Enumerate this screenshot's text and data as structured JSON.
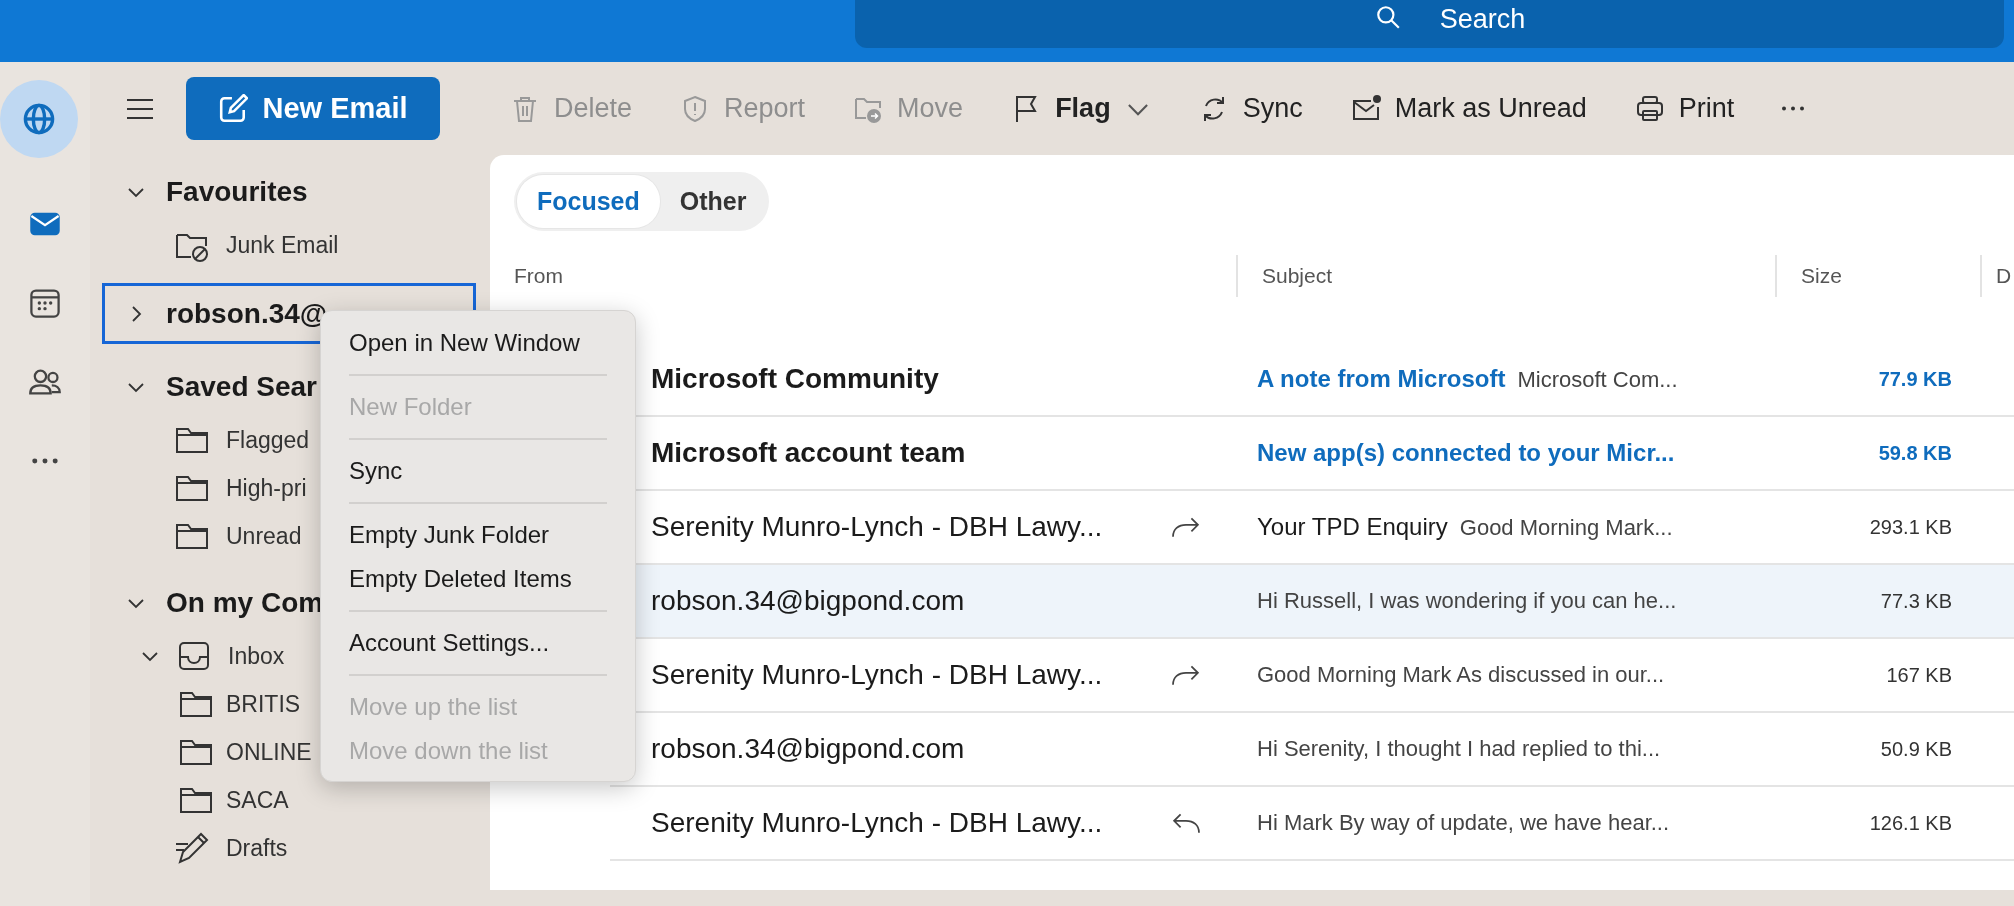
{
  "search": {
    "placeholder": "Search"
  },
  "rail": [
    {
      "kind": "globe",
      "selected": true
    },
    {
      "kind": "mail",
      "selected": false
    },
    {
      "kind": "calendar",
      "selected": false
    },
    {
      "kind": "people",
      "selected": false
    },
    {
      "kind": "more",
      "selected": false
    }
  ],
  "new_email": {
    "label": "New Email"
  },
  "toolbar": [
    {
      "kind": "delete",
      "label": "Delete",
      "disabled": true
    },
    {
      "kind": "report",
      "label": "Report",
      "disabled": true
    },
    {
      "kind": "move",
      "label": "Move",
      "disabled": true
    },
    {
      "kind": "flag",
      "label": "Flag",
      "disabled": false
    },
    {
      "kind": "sync",
      "label": "Sync",
      "disabled": false
    },
    {
      "kind": "unread",
      "label": "Mark as Unread",
      "disabled": false
    },
    {
      "kind": "print",
      "label": "Print",
      "disabled": false
    },
    {
      "kind": "more"
    }
  ],
  "sidebar": [
    {
      "kind": "group",
      "label": "Favourites",
      "expanded": true,
      "items": [
        {
          "kind": "junk",
          "label": "Junk Email"
        }
      ]
    },
    {
      "kind": "account",
      "label": "robson.34@",
      "expanded": false,
      "selected": true
    },
    {
      "kind": "group",
      "label": "Saved Sear",
      "expanded": true,
      "items": [
        {
          "kind": "folder",
          "label": "Flagged"
        },
        {
          "kind": "folder",
          "label": "High-pri"
        },
        {
          "kind": "folder",
          "label": "Unread"
        }
      ]
    },
    {
      "kind": "group",
      "label": "On my Com",
      "expanded": true,
      "items": [
        {
          "kind": "inbox",
          "label": "Inbox",
          "expanded": true,
          "children": [
            {
              "kind": "folder",
              "label": "BRITIS"
            },
            {
              "kind": "folder",
              "label": "ONLINE"
            },
            {
              "kind": "folder",
              "label": "SACA"
            }
          ]
        },
        {
          "kind": "drafts",
          "label": "Drafts"
        }
      ]
    }
  ],
  "tabs": [
    {
      "label": "Focused",
      "selected": true
    },
    {
      "label": "Other",
      "selected": false
    }
  ],
  "columns": [
    "From",
    "Subject",
    "Size",
    "D"
  ],
  "rows": [
    {
      "from": "Microsoft Community",
      "unread": true,
      "kind": "plain",
      "subject": "A note from Microsoft",
      "preview": "Microsoft Com...",
      "size": "77.9 KB",
      "selected": false
    },
    {
      "from": "Microsoft account team",
      "unread": true,
      "kind": "plain",
      "subject": "New app(s) connected to your Micr...",
      "size": "59.8 KB",
      "selected": false
    },
    {
      "from": "Serenity Munro-Lynch - DBH Lawy...",
      "unread": false,
      "kind": "forwarded",
      "subject": "Your TPD Enquiry",
      "preview": "Good Morning Mark...",
      "size": "293.1 KB",
      "selected": false
    },
    {
      "from": "robson.34@bigpond.com",
      "unread": false,
      "kind": "plain",
      "preview": "Hi Russell, I was wondering if you can he...",
      "size": "77.3 KB",
      "selected": true
    },
    {
      "from": "Serenity Munro-Lynch - DBH Lawy...",
      "unread": false,
      "kind": "forwarded",
      "preview": "Good Morning Mark As discussed in our...",
      "size": "167 KB",
      "selected": false
    },
    {
      "from": "robson.34@bigpond.com",
      "unread": false,
      "kind": "plain",
      "preview": "Hi Serenity, I thought I had replied to thi...",
      "size": "50.9 KB",
      "selected": false
    },
    {
      "from": "Serenity Munro-Lynch - DBH Lawy...",
      "unread": false,
      "kind": "replied",
      "preview": "Hi Mark By way of update, we have hear...",
      "size": "126.1 KB",
      "selected": false
    }
  ],
  "context_menu": {
    "groups": [
      [
        {
          "label": "Open in New Window",
          "disabled": false
        }
      ],
      [
        {
          "label": "New Folder",
          "disabled": true
        }
      ],
      [
        {
          "label": "Sync",
          "disabled": false
        }
      ],
      [
        {
          "label": "Empty Junk Folder",
          "disabled": false
        },
        {
          "label": "Empty Deleted Items",
          "disabled": false
        }
      ],
      [
        {
          "label": "Account Settings...",
          "disabled": false
        }
      ],
      [
        {
          "label": "Move up the list",
          "disabled": true
        },
        {
          "label": "Move down the list",
          "disabled": true
        }
      ]
    ]
  }
}
